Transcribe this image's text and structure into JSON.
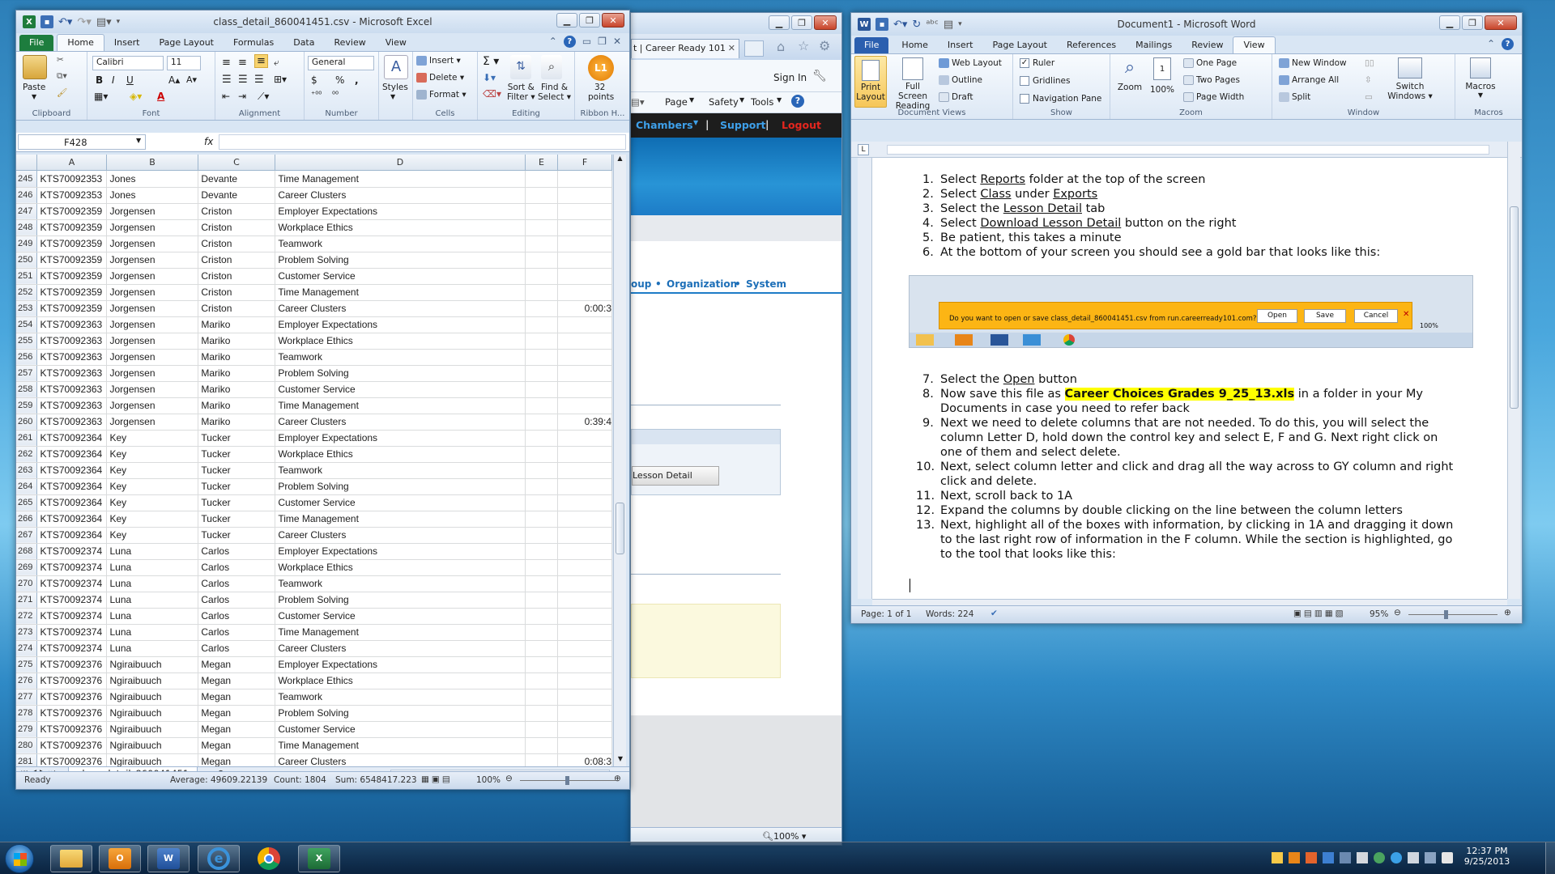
{
  "excel": {
    "title": "class_detail_860041451.csv - Microsoft Excel",
    "tabs": [
      "File",
      "Home",
      "Insert",
      "Page Layout",
      "Formulas",
      "Data",
      "Review",
      "View"
    ],
    "ribbon": {
      "clipboard": {
        "label": "Clipboard",
        "paste": "Paste"
      },
      "font": {
        "label": "Font",
        "name": "Calibri",
        "size": "11"
      },
      "alignment": {
        "label": "Alignment"
      },
      "number": {
        "label": "Number",
        "format": "General",
        "currency": "$",
        "percent": "%",
        "comma": ","
      },
      "styles": {
        "label": "Styles"
      },
      "cells": {
        "label": "Cells",
        "insert": "Insert",
        "delete": "Delete",
        "format": "Format"
      },
      "editing": {
        "label": "Editing",
        "sort": "Sort &",
        "sort2": "Filter",
        "find": "Find &",
        "find2": "Select"
      },
      "points": {
        "label": "Ribbon H...",
        "count": "32",
        "unit": "points",
        "badge": "L1"
      }
    },
    "namebox": "F428",
    "fx": "fx",
    "columns": [
      "A",
      "B",
      "C",
      "D",
      "E",
      "F"
    ],
    "rows": [
      {
        "n": "245",
        "a": "KTS70092353",
        "b": "Jones",
        "c": "Devante",
        "d": "Time Management",
        "f": ""
      },
      {
        "n": "246",
        "a": "KTS70092353",
        "b": "Jones",
        "c": "Devante",
        "d": "Career Clusters",
        "f": ""
      },
      {
        "n": "247",
        "a": "KTS70092359",
        "b": "Jorgensen",
        "c": "Criston",
        "d": "Employer Expectations",
        "f": ""
      },
      {
        "n": "248",
        "a": "KTS70092359",
        "b": "Jorgensen",
        "c": "Criston",
        "d": "Workplace Ethics",
        "f": ""
      },
      {
        "n": "249",
        "a": "KTS70092359",
        "b": "Jorgensen",
        "c": "Criston",
        "d": "Teamwork",
        "f": ""
      },
      {
        "n": "250",
        "a": "KTS70092359",
        "b": "Jorgensen",
        "c": "Criston",
        "d": "Problem Solving",
        "f": ""
      },
      {
        "n": "251",
        "a": "KTS70092359",
        "b": "Jorgensen",
        "c": "Criston",
        "d": "Customer Service",
        "f": ""
      },
      {
        "n": "252",
        "a": "KTS70092359",
        "b": "Jorgensen",
        "c": "Criston",
        "d": "Time Management",
        "f": ""
      },
      {
        "n": "253",
        "a": "KTS70092359",
        "b": "Jorgensen",
        "c": "Criston",
        "d": "Career Clusters",
        "f": "0:00:3"
      },
      {
        "n": "254",
        "a": "KTS70092363",
        "b": "Jorgensen",
        "c": "Mariko",
        "d": "Employer Expectations",
        "f": ""
      },
      {
        "n": "255",
        "a": "KTS70092363",
        "b": "Jorgensen",
        "c": "Mariko",
        "d": "Workplace Ethics",
        "f": ""
      },
      {
        "n": "256",
        "a": "KTS70092363",
        "b": "Jorgensen",
        "c": "Mariko",
        "d": "Teamwork",
        "f": ""
      },
      {
        "n": "257",
        "a": "KTS70092363",
        "b": "Jorgensen",
        "c": "Mariko",
        "d": "Problem Solving",
        "f": ""
      },
      {
        "n": "258",
        "a": "KTS70092363",
        "b": "Jorgensen",
        "c": "Mariko",
        "d": "Customer Service",
        "f": ""
      },
      {
        "n": "259",
        "a": "KTS70092363",
        "b": "Jorgensen",
        "c": "Mariko",
        "d": "Time Management",
        "f": ""
      },
      {
        "n": "260",
        "a": "KTS70092363",
        "b": "Jorgensen",
        "c": "Mariko",
        "d": "Career Clusters",
        "f": "0:39:4"
      },
      {
        "n": "261",
        "a": "KTS70092364",
        "b": "Key",
        "c": "Tucker",
        "d": "Employer Expectations",
        "f": ""
      },
      {
        "n": "262",
        "a": "KTS70092364",
        "b": "Key",
        "c": "Tucker",
        "d": "Workplace Ethics",
        "f": ""
      },
      {
        "n": "263",
        "a": "KTS70092364",
        "b": "Key",
        "c": "Tucker",
        "d": "Teamwork",
        "f": ""
      },
      {
        "n": "264",
        "a": "KTS70092364",
        "b": "Key",
        "c": "Tucker",
        "d": "Problem Solving",
        "f": ""
      },
      {
        "n": "265",
        "a": "KTS70092364",
        "b": "Key",
        "c": "Tucker",
        "d": "Customer Service",
        "f": ""
      },
      {
        "n": "266",
        "a": "KTS70092364",
        "b": "Key",
        "c": "Tucker",
        "d": "Time Management",
        "f": ""
      },
      {
        "n": "267",
        "a": "KTS70092364",
        "b": "Key",
        "c": "Tucker",
        "d": "Career Clusters",
        "f": ""
      },
      {
        "n": "268",
        "a": "KTS70092374",
        "b": "Luna",
        "c": "Carlos",
        "d": "Employer Expectations",
        "f": ""
      },
      {
        "n": "269",
        "a": "KTS70092374",
        "b": "Luna",
        "c": "Carlos",
        "d": "Workplace Ethics",
        "f": ""
      },
      {
        "n": "270",
        "a": "KTS70092374",
        "b": "Luna",
        "c": "Carlos",
        "d": "Teamwork",
        "f": ""
      },
      {
        "n": "271",
        "a": "KTS70092374",
        "b": "Luna",
        "c": "Carlos",
        "d": "Problem Solving",
        "f": ""
      },
      {
        "n": "272",
        "a": "KTS70092374",
        "b": "Luna",
        "c": "Carlos",
        "d": "Customer Service",
        "f": ""
      },
      {
        "n": "273",
        "a": "KTS70092374",
        "b": "Luna",
        "c": "Carlos",
        "d": "Time Management",
        "f": ""
      },
      {
        "n": "274",
        "a": "KTS70092374",
        "b": "Luna",
        "c": "Carlos",
        "d": "Career Clusters",
        "f": ""
      },
      {
        "n": "275",
        "a": "KTS70092376",
        "b": "Ngiraibuuch",
        "c": "Megan",
        "d": "Employer Expectations",
        "f": ""
      },
      {
        "n": "276",
        "a": "KTS70092376",
        "b": "Ngiraibuuch",
        "c": "Megan",
        "d": "Workplace Ethics",
        "f": ""
      },
      {
        "n": "277",
        "a": "KTS70092376",
        "b": "Ngiraibuuch",
        "c": "Megan",
        "d": "Teamwork",
        "f": ""
      },
      {
        "n": "278",
        "a": "KTS70092376",
        "b": "Ngiraibuuch",
        "c": "Megan",
        "d": "Problem Solving",
        "f": ""
      },
      {
        "n": "279",
        "a": "KTS70092376",
        "b": "Ngiraibuuch",
        "c": "Megan",
        "d": "Customer Service",
        "f": ""
      },
      {
        "n": "280",
        "a": "KTS70092376",
        "b": "Ngiraibuuch",
        "c": "Megan",
        "d": "Time Management",
        "f": ""
      },
      {
        "n": "281",
        "a": "KTS70092376",
        "b": "Ngiraibuuch",
        "c": "Megan",
        "d": "Career Clusters",
        "f": "0:08:3"
      }
    ],
    "sheet_tab": "class_detail_860041451",
    "status": {
      "ready": "Ready",
      "average": "Average: 49609.22139",
      "count": "Count: 1804",
      "sum": "Sum: 6548417.223",
      "zoom": "100%"
    }
  },
  "ie": {
    "tab": "t | Career Ready 101",
    "sign_in": "Sign In",
    "cmd": {
      "page": "Page",
      "safety": "Safety",
      "tools": "Tools"
    },
    "nav": {
      "chambers": "Chambers",
      "support": "Support",
      "logout": "Logout"
    },
    "subnav": {
      "group": "oup",
      "org": "Organization",
      "system": "System"
    },
    "lesson_btn": "Lesson Detail",
    "zoom": "100%"
  },
  "word": {
    "title": "Document1 - Microsoft Word",
    "tabs": [
      "File",
      "Home",
      "Insert",
      "Page Layout",
      "References",
      "Mailings",
      "Review",
      "View"
    ],
    "ribbon": {
      "views": {
        "label": "Document Views",
        "print": "Print",
        "print2": "Layout",
        "full": "Full Screen",
        "full2": "Reading",
        "web": "Web Layout",
        "outline": "Outline",
        "draft": "Draft"
      },
      "show": {
        "label": "Show",
        "ruler": "Ruler",
        "grid": "Gridlines",
        "nav": "Navigation Pane"
      },
      "zoom": {
        "label": "Zoom",
        "zoom": "Zoom",
        "pct": "100%",
        "one": "One Page",
        "two": "Two Pages",
        "width": "Page Width"
      },
      "window": {
        "label": "Window",
        "new": "New Window",
        "arrange": "Arrange All",
        "split": "Split",
        "switch": "Switch",
        "switch2": "Windows"
      },
      "macros": {
        "label": "Macros",
        "macros": "Macros"
      }
    },
    "doc": {
      "i1": {
        "num": "1.",
        "pre": "Select ",
        "u": "Reports",
        "post": " folder at the top of the screen"
      },
      "i2": {
        "num": "2.",
        "pre": "Select ",
        "u": "Class",
        "mid": " under ",
        "u2": "Exports"
      },
      "i3": {
        "num": "3.",
        "pre": "Select the ",
        "u": "Lesson Detail",
        "post": " tab"
      },
      "i4": {
        "num": "4.",
        "pre": "Select ",
        "u": "Download Lesson Detail",
        "post": " button on the right"
      },
      "i5": {
        "num": "5.",
        "text": "Be patient, this takes a minute"
      },
      "i6": {
        "num": "6.",
        "text": "At the bottom of your screen you should see a gold bar that looks like this:"
      },
      "goldbar": {
        "text": "Do you want to open or save class_detail_860041451.csv from run.careerready101.com?",
        "open": "Open",
        "save": "Save",
        "cancel": "Cancel",
        "zoom": "100%"
      },
      "i7": {
        "num": "7.",
        "pre": "Select the ",
        "u": "Open",
        "post": " button"
      },
      "i8": {
        "num": "8.",
        "pre": "Now save this file as ",
        "hl": "Career Choices Grades 9_25_13.xls",
        "post": "  in a folder in your My Documents in case you need to refer back"
      },
      "i9": {
        "num": "9.",
        "text": "Next we need to delete columns that are not needed.  To do this, you will select the column Letter D, hold down the control key and select E, F and G.  Next right click on one of them and select delete."
      },
      "i10": {
        "num": "10.",
        "text": " Next, select column letter and click and drag all the way across to GY column and right click and delete."
      },
      "i11": {
        "num": "11.",
        "text": " Next, scroll back to 1A"
      },
      "i12": {
        "num": "12.",
        "text": " Expand the columns by double clicking on the line between the column letters"
      },
      "i13": {
        "num": "13.",
        "text": " Next, highlight all of the boxes with information, by clicking in 1A and dragging it down to the last right row of information in the F column.  While the section is highlighted,  go to the tool that looks like this:"
      }
    },
    "status": {
      "page": "Page: 1 of 1",
      "words": "Words: 224",
      "zoom": "95%"
    }
  },
  "taskbar": {
    "time": "12:37 PM",
    "date": "9/25/2013"
  },
  "colors": {
    "excel_green": "#1f7c3c",
    "word_blue": "#2a5699",
    "file_excel": "#1d7d3e",
    "file_word": "#2b5faf",
    "ie_nav": "#1d1d1d",
    "ie_blue": "#1d7cc7"
  }
}
